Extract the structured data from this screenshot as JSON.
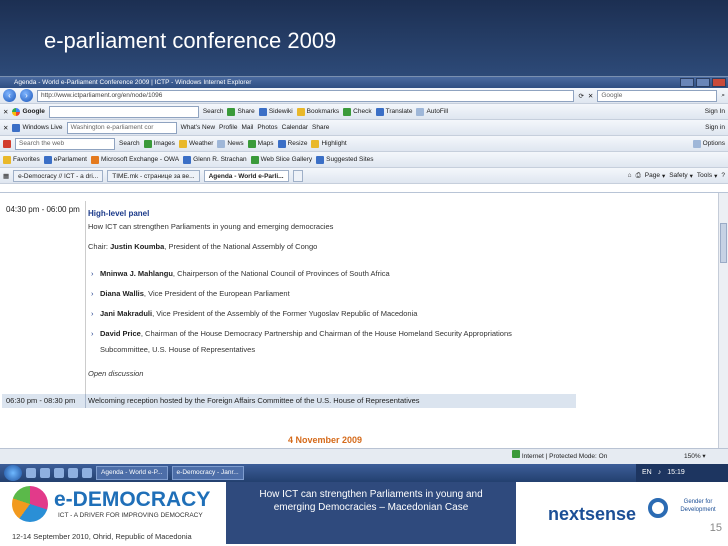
{
  "slide": {
    "title": "e-parliament conference 2009",
    "number": "15"
  },
  "browser": {
    "window_title": "Agenda - World e-Parliament Conference 2009 | ICTP - Windows Internet Explorer",
    "address": "http://www.ictparliament.org/en/node/1096",
    "address_domain": "ictparliament.org",
    "search_engine": "Google",
    "google_toolbar": {
      "label": "Google",
      "search_btn": "Search",
      "items": [
        "Share",
        "Sidewiki",
        "Bookmarks",
        "Check",
        "Translate",
        "AutoFill"
      ],
      "signin": "Sign In"
    },
    "live_toolbar": {
      "label": "Windows Live",
      "search_value": "Washington e-parliament cor",
      "items": [
        "What's New",
        "Profile",
        "Mail",
        "Photos",
        "Calendar",
        "Share"
      ],
      "signin": "Sign in"
    },
    "web_toolbar": {
      "search_placeholder": "Search the web",
      "search_btn": "Search",
      "items": [
        "Images",
        "Weather",
        "News",
        "Maps",
        "Resize",
        "Highlight"
      ],
      "options": "Options"
    },
    "favorites": {
      "label": "Favorites",
      "items": [
        "eParlament",
        "Microsoft Exchange - OWA",
        "Glenn R. Strachan",
        "Web Slice Gallery",
        "Suggested Sites"
      ]
    },
    "tabs": [
      "e-Democracy // ICT - a dri...",
      "TIME.mk - странице за ве...",
      "Agenda - World e-Parli..."
    ],
    "command_items": [
      "Page",
      "Safety",
      "Tools"
    ],
    "status": {
      "zone": "Internet | Protected Mode: On",
      "zoom": "150%"
    }
  },
  "schedule": {
    "session1": {
      "time": "04:30 pm - 06:00 pm",
      "heading": "High-level panel",
      "topic": "How ICT can strengthen Parliaments in young and emerging democracies",
      "chair_label": "Chair:",
      "chair_name": "Justin Koumba",
      "chair_role": ", President of the National Assembly of Congo",
      "speakers": [
        {
          "name": "Mninwa J. Mahlangu",
          "role": ", Chairperson of the National Council of Provinces of South Africa"
        },
        {
          "name": "Diana Wallis",
          "role": ", Vice President of the European Parliament"
        },
        {
          "name": "Jani Makraduli",
          "role": ", Vice President of the Assembly of the Former Yugoslav Republic of Macedonia"
        },
        {
          "name": "David Price",
          "role": ", Chairman of the House Democracy Partnership  and Chairman of the House Homeland Security Appropriations"
        }
      ],
      "speaker4_cont": "Subcommittee, U.S. House of Representatives",
      "discussion": "Open discussion"
    },
    "session2": {
      "time": "06:30 pm - 08:30 pm",
      "event": "Welcoming reception hosted by the Foreign Affairs Committee of the U.S. House of Representatives"
    },
    "next_date": "4 November 2009"
  },
  "taskbar": {
    "buttons": [
      "Agenda - World e-P...",
      "e-Democracy - Janr..."
    ],
    "lang": "EN",
    "clock": "15:19"
  },
  "footer": {
    "logo": "e-DEMOCRACY",
    "tagline": "ICT - A DRIVER FOR IMPROVING DEMOCRACY",
    "event_date": "12-14 September 2010, Ohrid, Republic of Macedonia",
    "caption_line1": "How ICT can strengthen Parliaments in young and",
    "caption_line2": "emerging Democracies – Macedonian Case",
    "brand": "nextsense",
    "partner": "Gender for Development"
  }
}
